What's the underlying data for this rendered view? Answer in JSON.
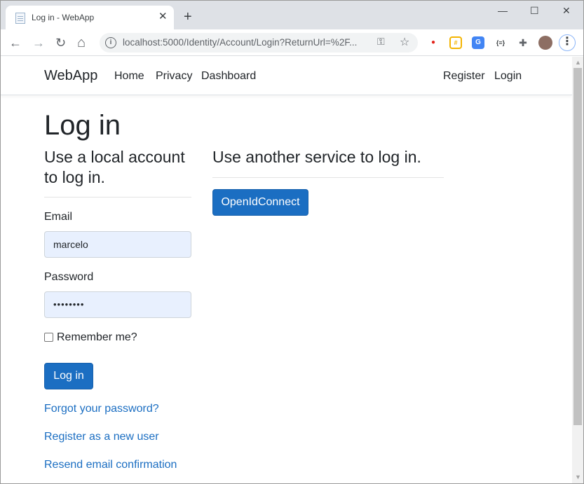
{
  "browser": {
    "tab_title": "Log in - WebApp",
    "tab_close": "✕",
    "new_tab": "+",
    "window_minimize": "—",
    "window_maximize": "☐",
    "window_close": "✕",
    "back": "←",
    "forward": "→",
    "reload": "↻",
    "home": "⌂",
    "url": "localhost:5000/Identity/Account/Login?ReturnUrl=%2F...",
    "info_icon": "i",
    "key_icon": "⚿",
    "star_icon": "☆",
    "extensions": [
      {
        "name": "adblock-extension-icon",
        "glyph": "●",
        "color": "#e2231a"
      },
      {
        "name": "hashtag-extension-icon",
        "glyph": "#",
        "color": "#f4b400"
      },
      {
        "name": "translate-extension-icon",
        "glyph": "G",
        "color": "#4285f4"
      },
      {
        "name": "json-extension-icon",
        "glyph": "{≡}",
        "color": "#3c4043"
      },
      {
        "name": "puzzle-extension-icon",
        "glyph": "✚",
        "color": "#5f6368"
      }
    ],
    "menu_icon": "⋮"
  },
  "navbar": {
    "brand": "WebApp",
    "links": [
      "Home",
      "Privacy",
      "Dashboard"
    ],
    "register": "Register",
    "login": "Login"
  },
  "page": {
    "title": "Log in",
    "local_heading_line1": "Use a local account",
    "local_heading_line2": "to log in.",
    "email_label": "Email",
    "email_value": "marcelo",
    "password_label": "Password",
    "password_value": "••••••••",
    "remember_label": "Remember me?",
    "login_button": "Log in",
    "forgot_link": "Forgot your password?",
    "register_link": "Register as a new user",
    "resend_link": "Resend email confirmation",
    "external_heading": "Use another service to log in.",
    "openid_button": "OpenIdConnect"
  },
  "scrollbar": {
    "up": "▲",
    "down": "▼"
  }
}
